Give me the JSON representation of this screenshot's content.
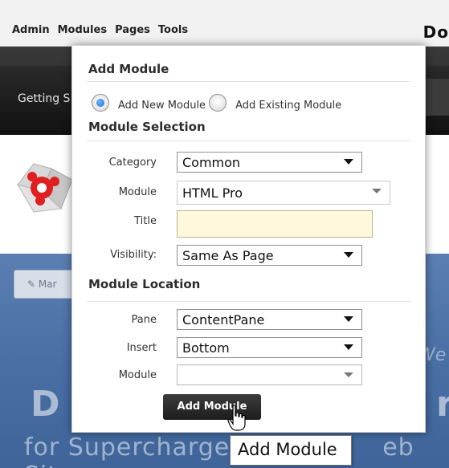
{
  "topbar": {
    "menu": [
      "Admin",
      "Modules",
      "Pages",
      "Tools"
    ],
    "brand_partial": "Do"
  },
  "nav": {
    "getting_started": "Getting S"
  },
  "hero": {
    "manage_label": "Mar",
    "big_text_left": "D",
    "big_text_right": "r",
    "sub_text": "for Supercharge",
    "sub_text_right": "eb Site",
    "we": "We"
  },
  "popup": {
    "add_module_title": "Add Module",
    "radio_options": [
      {
        "label": "Add New Module",
        "checked": true
      },
      {
        "label": "Add Existing Module",
        "checked": false
      }
    ],
    "module_selection_title": "Module Selection",
    "fields": {
      "category": {
        "label": "Category",
        "value": "Common"
      },
      "module": {
        "label": "Module",
        "value": "HTML Pro"
      },
      "title": {
        "label": "Title",
        "value": ""
      },
      "visibility": {
        "label": "Visibility:",
        "value": "Same As Page"
      }
    },
    "module_location_title": "Module Location",
    "location": {
      "pane": {
        "label": "Pane",
        "value": "ContentPane"
      },
      "insert": {
        "label": "Insert",
        "value": "Bottom"
      },
      "module": {
        "label": "Module",
        "value": ""
      }
    },
    "add_button": "Add Module"
  },
  "tooltip": "Add Module",
  "colors": {
    "accent_blue": "#1f6fd6",
    "hero_blue": "#4a6fa5",
    "title_input_bg": "#fff8dc",
    "dark_band": "#1e1e1e"
  },
  "icons": {
    "logo": "red-gear-logo-icon",
    "cursor": "hand-pointer-icon",
    "manage": "pencil-icon"
  }
}
